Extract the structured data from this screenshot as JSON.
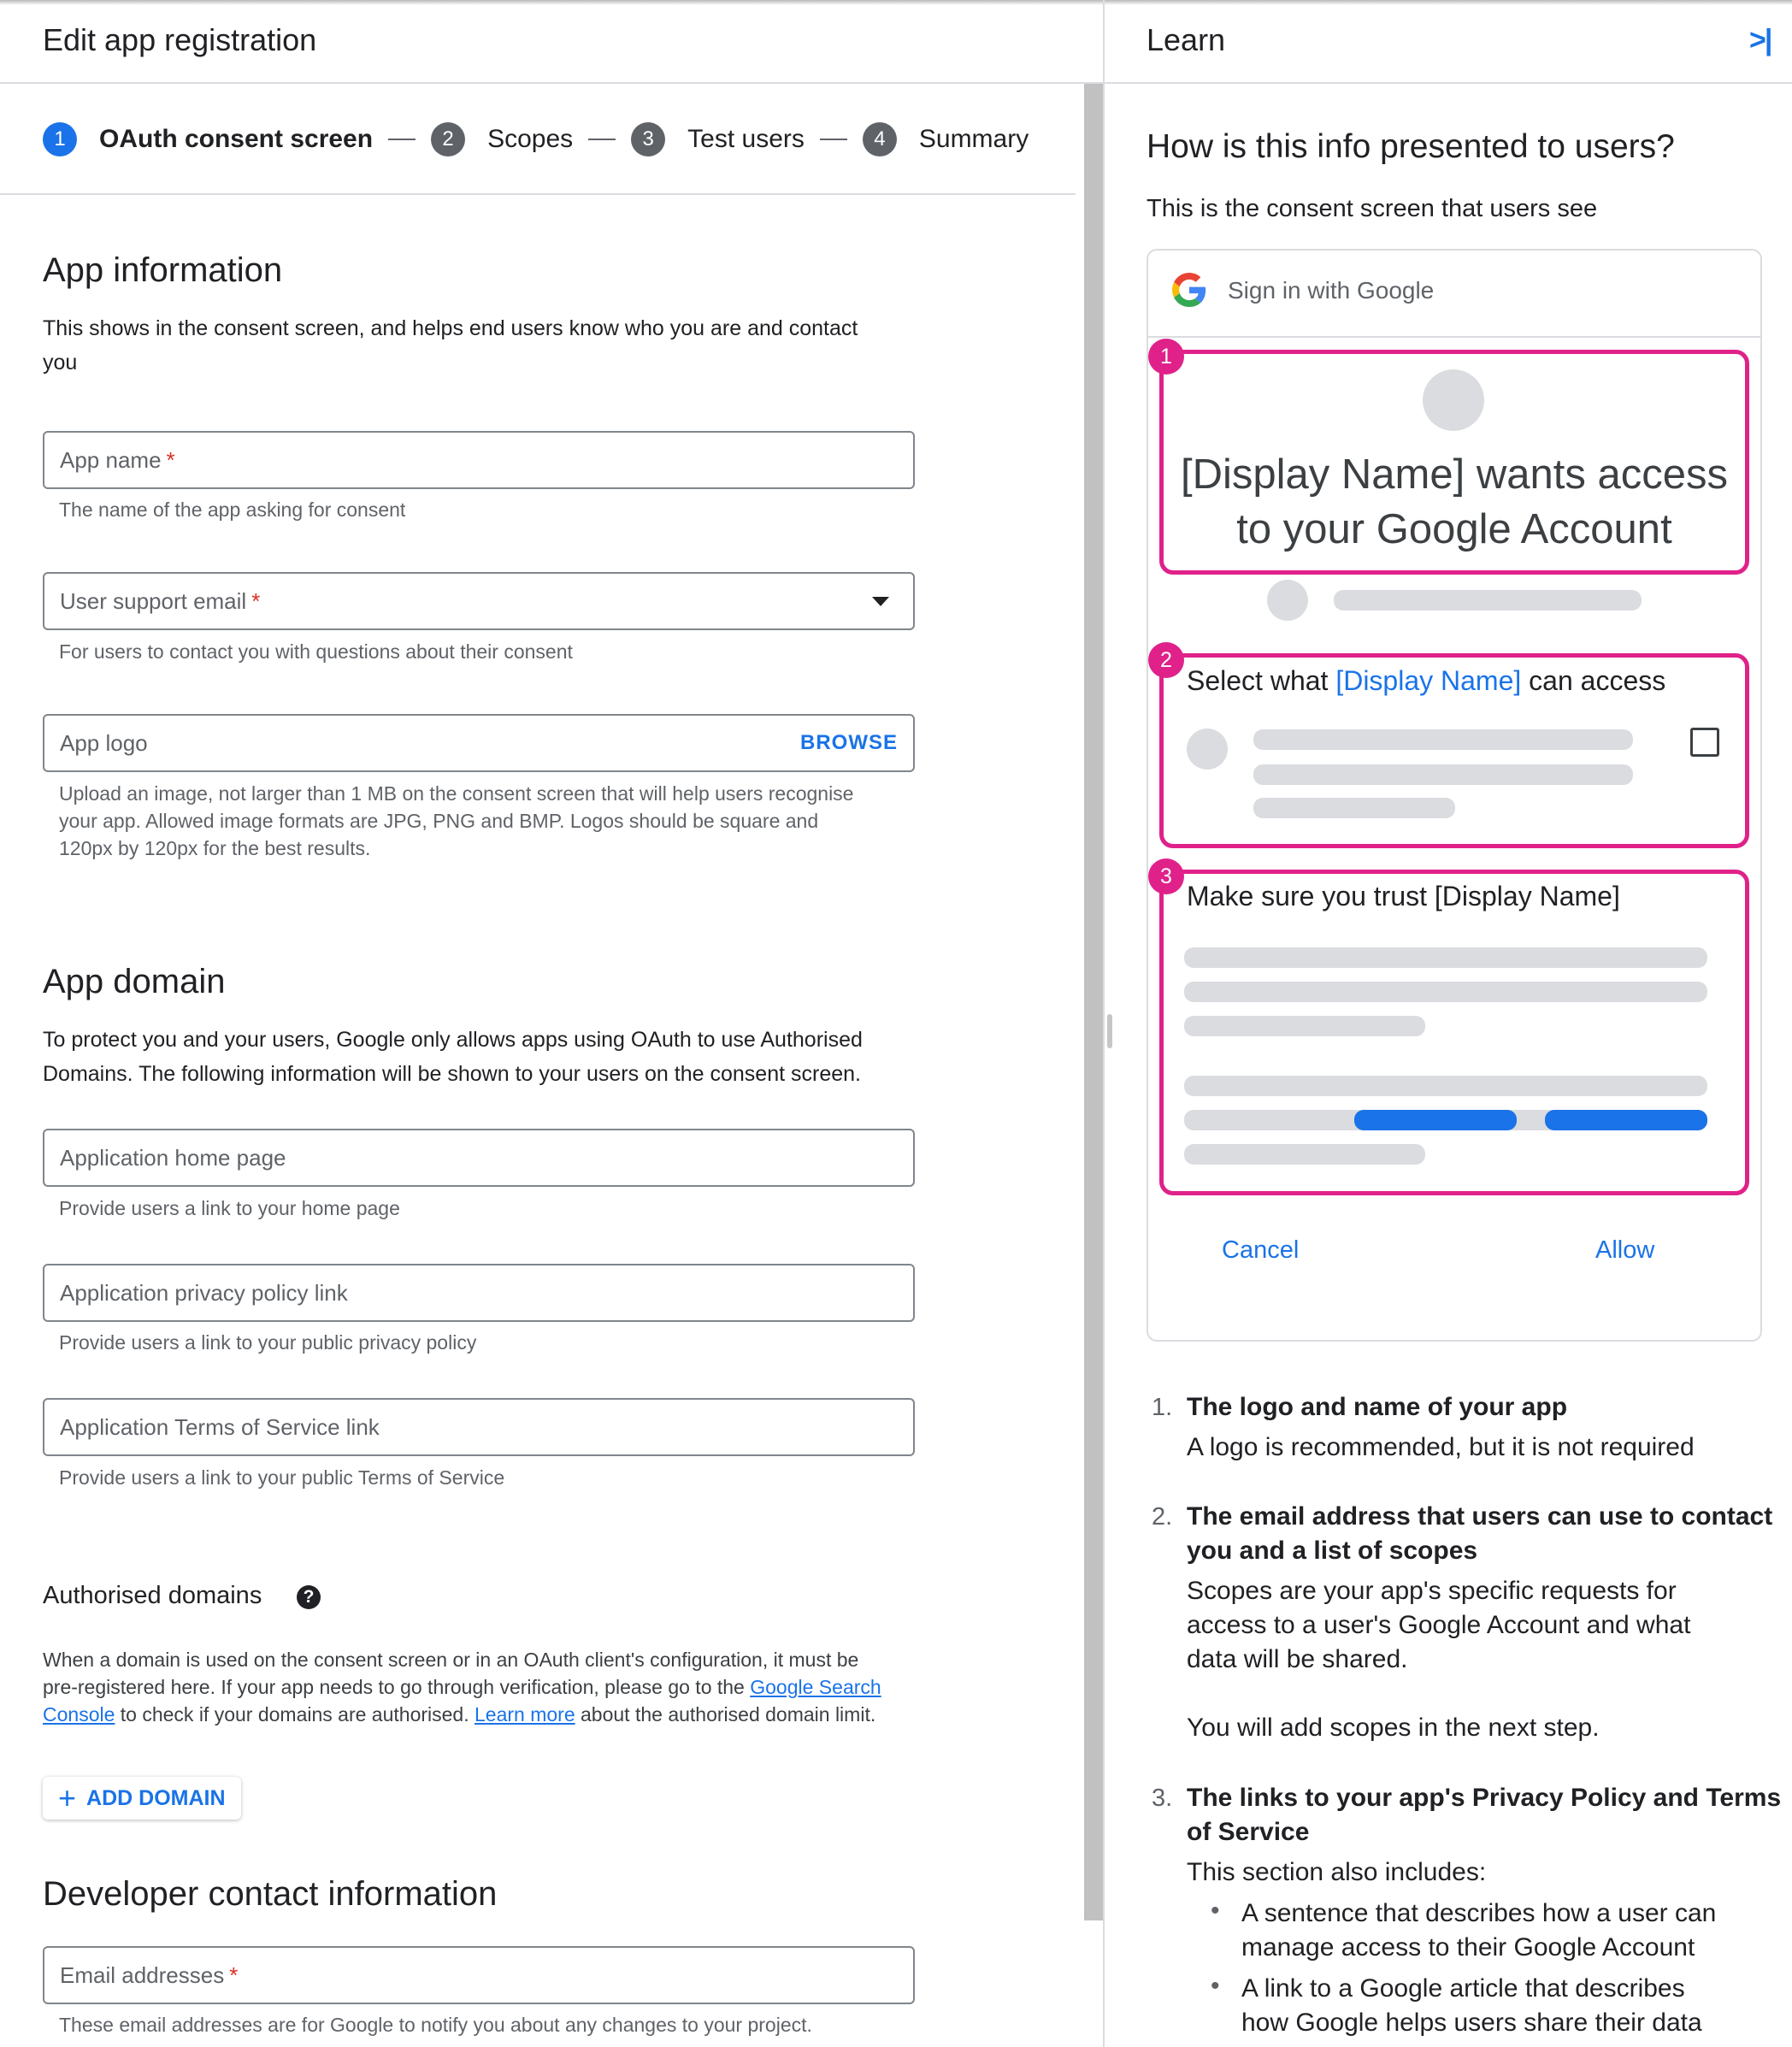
{
  "left_panel": {
    "title": "Edit app registration",
    "stepper": [
      {
        "num": "1",
        "label": "OAuth consent screen"
      },
      {
        "num": "2",
        "label": "Scopes"
      },
      {
        "num": "3",
        "label": "Test users"
      },
      {
        "num": "4",
        "label": "Summary"
      }
    ],
    "app_information": {
      "heading": "App information",
      "description_1": "This shows in the consent screen, and helps end users know who you are and contact",
      "description_2": "you",
      "app_name": {
        "label": "App name",
        "required": "*",
        "helper": "The name of the app asking for consent"
      },
      "user_support_email": {
        "label": "User support email",
        "required": "*",
        "helper": "For users to contact you with questions about their consent"
      },
      "app_logo": {
        "label": "App logo",
        "browse": "BROWSE",
        "helper_1": "Upload an image, not larger than 1 MB on the consent screen that will help users recognise",
        "helper_2": "your app. Allowed image formats are JPG, PNG and BMP. Logos should be square and",
        "helper_3": "120px by 120px for the best results."
      }
    },
    "app_domain": {
      "heading": "App domain",
      "description_1": "To protect you and your users, Google only allows apps using OAuth to use Authorised",
      "description_2": "Domains. The following information will be shown to your users on the consent screen.",
      "home_page": {
        "label": "Application home page",
        "helper": "Provide users a link to your home page"
      },
      "privacy": {
        "label": "Application privacy policy link",
        "helper": "Provide users a link to your public privacy policy"
      },
      "tos": {
        "label": "Application Terms of Service link",
        "helper": "Provide users a link to your public Terms of Service"
      }
    },
    "authorised_domains": {
      "heading": "Authorised domains",
      "help_icon": "?",
      "line_1": "When a domain is used on the consent screen or in an OAuth client's configuration, it must be",
      "line_2a": "pre-registered here. If your app needs to go through verification, please go to the",
      "link_gsc_1": "Google Search",
      "link_gsc_2": "Console",
      "line_3a": "to check if your domains are authorised.",
      "link_learn": "Learn more",
      "line_3b": "about the authorised domain limit.",
      "add_domain_icon": "+",
      "add_domain": "ADD DOMAIN"
    },
    "developer_contact": {
      "heading": "Developer contact information",
      "email": {
        "label": "Email addresses",
        "required": "*",
        "helper": "These email addresses are for Google to notify you about any changes to your project."
      }
    }
  },
  "right_panel": {
    "title": "Learn",
    "collapse_icon": ">|",
    "heading": "How is this info presented to users?",
    "subheading": "This is the consent screen that users see",
    "mock": {
      "header": "Sign in with Google",
      "section1": {
        "badge": "1",
        "line_1": "[Display Name] wants access",
        "line_2": "to your Google Account"
      },
      "section2": {
        "badge": "2",
        "pre": "Select what",
        "name": "[Display Name]",
        "post": "can access"
      },
      "section3": {
        "badge": "3",
        "title": "Make sure you trust [Display Name]"
      },
      "cancel": "Cancel",
      "allow": "Allow"
    },
    "list": [
      {
        "num": "1.",
        "title": "The logo and name of your app",
        "body": "A logo is recommended, but it is not required"
      },
      {
        "num": "2.",
        "title_1": "The email address that users can use to contact",
        "title_2": "you and a list of scopes",
        "body_1": "Scopes are your app's specific requests for",
        "body_2": "access to a user's Google Account and what",
        "body_3": "data will be shared.",
        "body_4": "You will add scopes in the next step."
      },
      {
        "num": "3.",
        "title_1": "The links to your app's Privacy Policy and Terms",
        "title_2": "of Service",
        "body": "This section also includes:",
        "bullets": [
          {
            "mark": "•",
            "line_1": "A sentence that describes how a user can",
            "line_2": "manage access to their Google Account"
          },
          {
            "mark": "•",
            "line_1": "A link to a Google article that describes",
            "line_2": "how Google helps users share their data"
          }
        ]
      }
    ]
  }
}
